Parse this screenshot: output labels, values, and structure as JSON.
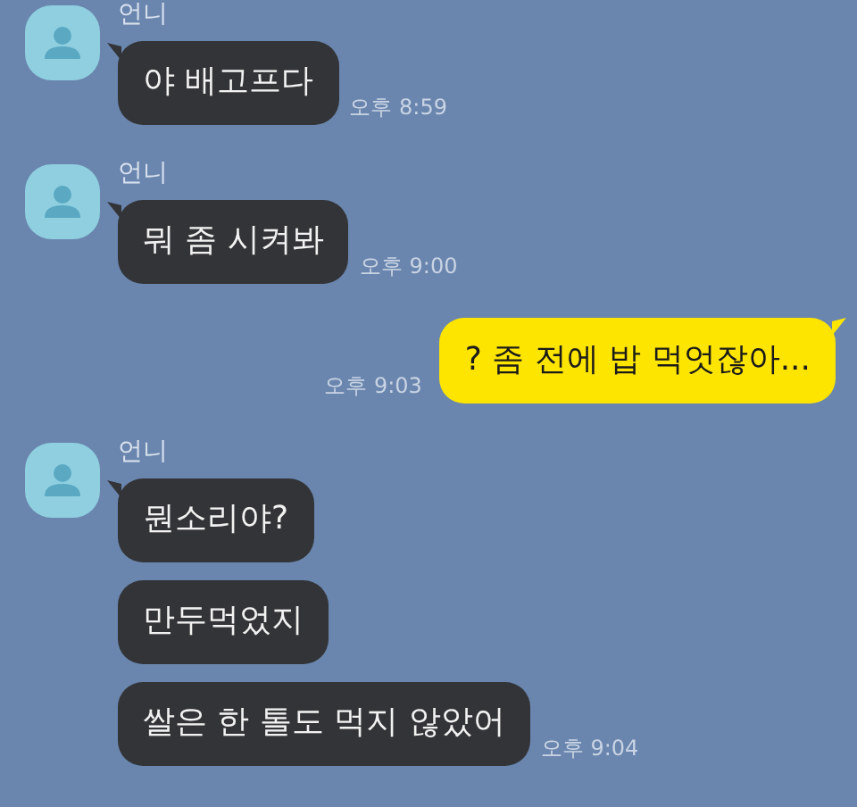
{
  "groups": [
    {
      "kind": "incoming",
      "sender": "언니",
      "messages": [
        {
          "text": "야 배고프다",
          "time": "오후 8:59"
        }
      ]
    },
    {
      "kind": "incoming",
      "sender": "언니",
      "messages": [
        {
          "text": "뭐 좀 시켜봐",
          "time": "오후 9:00"
        }
      ]
    },
    {
      "kind": "outgoing",
      "messages": [
        {
          "text": "? 좀 전에 밥 먹엇잖아...",
          "time": "오후 9:03"
        }
      ]
    },
    {
      "kind": "incoming",
      "sender": "언니",
      "messages": [
        {
          "text": "뭔소리야?"
        },
        {
          "text": "만두먹었지"
        },
        {
          "text": "쌀은 한 톨도 먹지 않았어",
          "time": "오후 9:04"
        }
      ]
    }
  ]
}
